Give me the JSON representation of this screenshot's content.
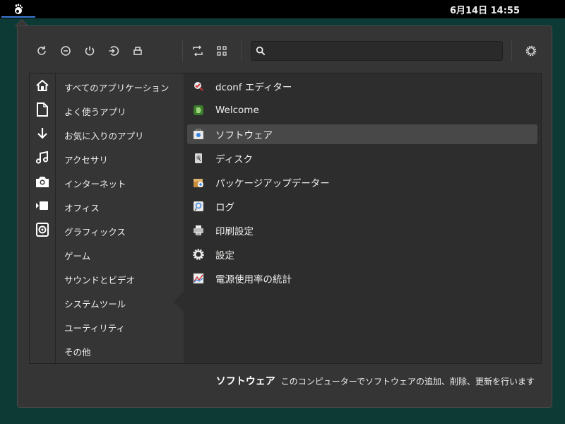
{
  "topbar": {
    "activities_icon": "gnome-foot-icon",
    "clock": "6月14日 14:55"
  },
  "toolbar": {
    "buttons": [
      "reload-icon",
      "lock-icon",
      "power-icon",
      "logout-icon",
      "suspend-icon",
      "switch-view-icon",
      "grid-view-icon"
    ],
    "search": {
      "value": "",
      "placeholder": ""
    },
    "settings_icon": "settings-gear-icon"
  },
  "sidebar_icons": [
    "home-icon",
    "document-icon",
    "download-icon",
    "music-icon",
    "camera-icon",
    "video-icon",
    "picture-icon"
  ],
  "categories": [
    "すべてのアプリケーション",
    "よく使うアプリ",
    "お気に入りのアプリ",
    "アクセサリ",
    "インターネット",
    "オフィス",
    "グラフィックス",
    "ゲーム",
    "サウンドとビデオ",
    "システムツール",
    "ユーティリティ",
    "その他"
  ],
  "selected_category": "システムツール",
  "apps": [
    {
      "label": "dconf エディター",
      "icon": "dconf-icon"
    },
    {
      "label": "Welcome",
      "icon": "welcome-icon"
    },
    {
      "label": "ソフトウェア",
      "icon": "software-icon"
    },
    {
      "label": "ディスク",
      "icon": "disk-icon"
    },
    {
      "label": "パッケージアップデーター",
      "icon": "package-updater-icon"
    },
    {
      "label": "ログ",
      "icon": "log-icon"
    },
    {
      "label": "印刷設定",
      "icon": "printer-icon"
    },
    {
      "label": "設定",
      "icon": "settings-icon"
    },
    {
      "label": "電源使用率の統計",
      "icon": "power-stats-icon"
    }
  ],
  "selected_app": "ソフトウェア",
  "description": {
    "title": "ソフトウェア",
    "text": "このコンピューターでソフトウェアの追加、削除、更新を行います"
  },
  "colors": {
    "desktop": "#0e3a35",
    "popup": "#353535",
    "panel": "#2d2d2d",
    "selected": "#484848",
    "accent": "#3f7bd6"
  }
}
